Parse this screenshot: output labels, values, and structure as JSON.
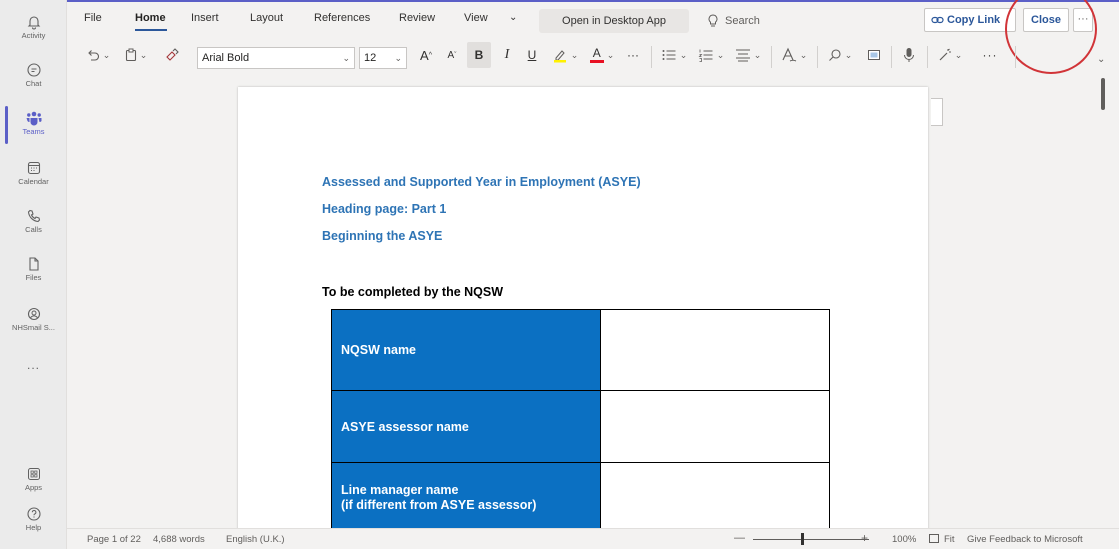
{
  "rail": {
    "items": [
      {
        "label": "Activity",
        "icon": "bell-icon"
      },
      {
        "label": "Chat",
        "icon": "chat-icon"
      },
      {
        "label": "Teams",
        "icon": "teams-icon"
      },
      {
        "label": "Calendar",
        "icon": "calendar-icon"
      },
      {
        "label": "Calls",
        "icon": "phone-icon"
      },
      {
        "label": "Files",
        "icon": "file-icon"
      },
      {
        "label": "NHSmail S...",
        "icon": "headset-icon"
      }
    ],
    "more": "...",
    "apps_label": "Apps",
    "help_label": "Help",
    "accent": "#5b5fc7"
  },
  "menu": {
    "tabs": [
      "File",
      "Home",
      "Insert",
      "Layout",
      "References",
      "Review",
      "View"
    ],
    "active_tab": "Home",
    "open_desktop": "Open in Desktop App",
    "search": "Search",
    "copy_link": "Copy Link",
    "close": "Close",
    "more": "···"
  },
  "toolbar": {
    "font": "Arial Bold",
    "size": "12",
    "grow": "A",
    "shrink": "A",
    "bold": "B",
    "italic": "I",
    "underline": "U",
    "font_color": "A",
    "overflow": "···",
    "more": "···"
  },
  "document": {
    "headings": [
      "Assessed and Supported Year in Employment (ASYE)",
      "Heading page: Part 1",
      "Beginning the ASYE"
    ],
    "subheading": "To be completed by the NQSW",
    "table_rows": [
      {
        "label_lines": [
          "NQSW name"
        ],
        "value": ""
      },
      {
        "label_lines": [
          "ASYE assessor name"
        ],
        "value": ""
      },
      {
        "label_lines": [
          "Line manager name",
          "(if different from ASYE assessor)"
        ],
        "value": ""
      }
    ],
    "heading_color": "#2e74b5",
    "table_color": "#0b70c2"
  },
  "status": {
    "page": "Page 1 of 22",
    "words": "4,688 words",
    "language": "English (U.K.)",
    "zoom_minus": "—",
    "zoom_plus": "+",
    "zoom": "100%",
    "fit": "Fit",
    "feedback": "Give Feedback to Microsoft"
  }
}
